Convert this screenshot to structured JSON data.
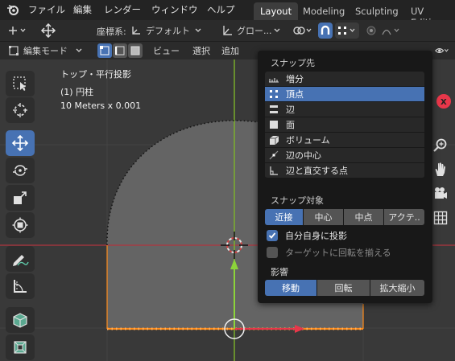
{
  "menubar": {
    "items": [
      "ファイル",
      "編集",
      "レンダー",
      "ウィンドウ",
      "ヘルプ"
    ],
    "workspaces": [
      "Layout",
      "Modeling",
      "Sculpting",
      "UV Editir"
    ],
    "active_workspace": "Layout"
  },
  "header": {
    "coord_label": "座標系:",
    "coord_value": "デフォルト",
    "pivot_value": "グロー...",
    "mode_label": "編集モード",
    "menus": [
      "ビュー",
      "選択",
      "追加"
    ]
  },
  "viewport": {
    "view_name": "トップ・平行投影",
    "object_name": "(1) 円柱",
    "scale_text": "10 Meters x 0.001"
  },
  "snap_popover": {
    "title_snap_to": "スナップ先",
    "snap_targets": [
      {
        "label": "増分",
        "icon": "increment-icon",
        "selected": false
      },
      {
        "label": "頂点",
        "icon": "vertex-icon",
        "selected": true
      },
      {
        "label": "辺",
        "icon": "edge-icon",
        "selected": false
      },
      {
        "label": "面",
        "icon": "face-icon",
        "selected": false
      },
      {
        "label": "ボリューム",
        "icon": "volume-icon",
        "selected": false
      },
      {
        "label": "辺の中心",
        "icon": "edge-center-icon",
        "selected": false
      },
      {
        "label": "辺と直交する点",
        "icon": "edge-perpendicular-icon",
        "selected": false
      }
    ],
    "title_snap_with": "スナップ対象",
    "snap_with": [
      "近接",
      "中心",
      "中点",
      "アクテ.."
    ],
    "snap_with_active": "近接",
    "include_self_label": "自分自身に投影",
    "include_self_checked": true,
    "align_rotation_label": "ターゲットに回転を揃える",
    "align_rotation_checked": false,
    "title_affect": "影響",
    "affect": [
      "移動",
      "回転",
      "拡大縮小"
    ],
    "affect_active": "移動"
  },
  "colors": {
    "accent": "#4772b3",
    "viewport_bg": "#393939",
    "x_axis": "#b0353f",
    "y_axis": "#7db32a",
    "edge_selected": "#ff8c1a"
  }
}
